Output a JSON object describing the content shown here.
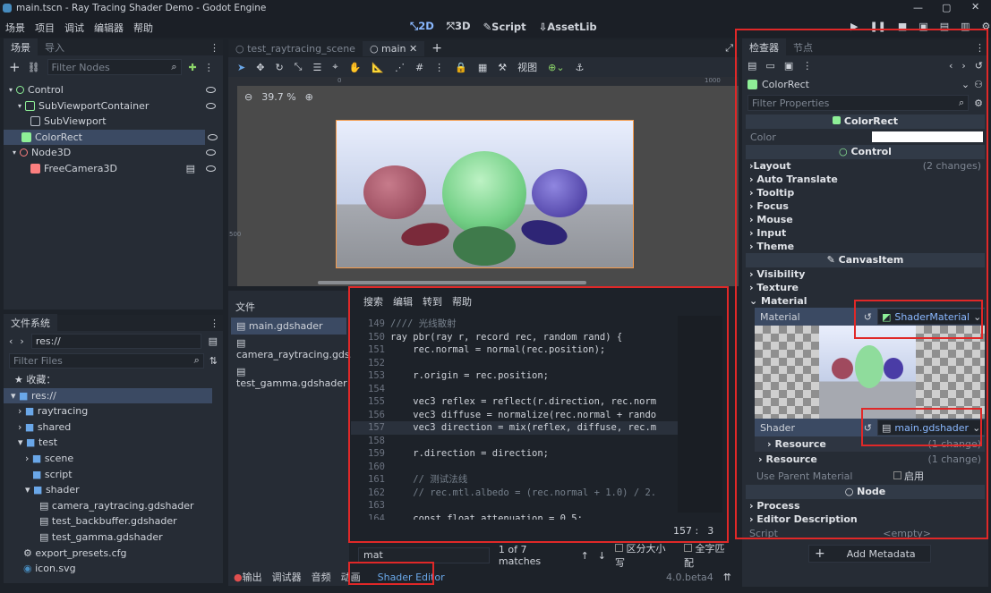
{
  "window": {
    "title": "main.tscn - Ray Tracing Shader Demo - Godot Engine"
  },
  "menu": [
    "场景",
    "项目",
    "调试",
    "编辑器",
    "帮助"
  ],
  "main_tabs": [
    {
      "label": "2D",
      "active": true
    },
    {
      "label": "3D"
    },
    {
      "label": "Script"
    },
    {
      "label": "AssetLib"
    }
  ],
  "scene_dock": {
    "tabs": [
      "场景",
      "导入"
    ],
    "filter_placeholder": "Filter Nodes",
    "nodes": [
      {
        "label": "Control",
        "icon": "control-icon"
      },
      {
        "label": "SubViewportContainer",
        "icon": "container-icon"
      },
      {
        "label": "SubViewport",
        "icon": "viewport-icon"
      },
      {
        "label": "ColorRect",
        "icon": "colorrect-icon",
        "selected": true
      },
      {
        "label": "Node3D",
        "icon": "node3d-icon"
      },
      {
        "label": "FreeCamera3D",
        "icon": "camera-icon"
      }
    ]
  },
  "filesystem": {
    "title": "文件系统",
    "path": "res://",
    "filter_placeholder": "Filter Files",
    "favorites": "收藏：",
    "items": [
      {
        "label": "res://",
        "selected": true
      },
      {
        "label": "raytracing"
      },
      {
        "label": "shared"
      },
      {
        "label": "test"
      },
      {
        "label": "scene"
      },
      {
        "label": "script"
      },
      {
        "label": "shader"
      },
      {
        "label": "camera_raytracing.gdshader"
      },
      {
        "label": "test_backbuffer.gdshader"
      },
      {
        "label": "test_gamma.gdshader"
      },
      {
        "label": "export_presets.cfg"
      },
      {
        "label": "icon.svg"
      }
    ]
  },
  "editor_tabs": [
    {
      "label": "test_raytracing_scene"
    },
    {
      "label": "main",
      "active": true
    }
  ],
  "viewport": {
    "zoom": "39.7 %",
    "view_menu": "视图",
    "ruler_marks": [
      "0",
      "1000",
      "500"
    ]
  },
  "shader_files": {
    "title": "文件",
    "items": [
      "main.gdshader",
      "camera_raytracing.gds...",
      "test_gamma.gdshader"
    ]
  },
  "shader_menu": [
    "搜索",
    "编辑",
    "转到",
    "帮助"
  ],
  "code_lines": [
    {
      "n": "149",
      "t": "//// 光线散射"
    },
    {
      "n": "150",
      "t": "ray pbr(ray r, record rec, random rand) {"
    },
    {
      "n": "151",
      "t": "    rec.normal = normal(rec.position);"
    },
    {
      "n": "152",
      "t": ""
    },
    {
      "n": "153",
      "t": "    r.origin = rec.position;"
    },
    {
      "n": "154",
      "t": ""
    },
    {
      "n": "155",
      "t": "    vec3 reflex = reflect(r.direction, rec.norm"
    },
    {
      "n": "156",
      "t": "    vec3 diffuse = normalize(rec.normal + rando"
    },
    {
      "n": "157",
      "t": "    vec3 direction = mix(reflex, diffuse, rec.m"
    },
    {
      "n": "158",
      "t": ""
    },
    {
      "n": "159",
      "t": "    r.direction = direction;"
    },
    {
      "n": "160",
      "t": ""
    },
    {
      "n": "161",
      "t": "    // 测试法线"
    },
    {
      "n": "162",
      "t": "    // rec.mtl.albedo = (rec.normal + 1.0) / 2."
    },
    {
      "n": "163",
      "t": ""
    },
    {
      "n": "164",
      "t": "    const float attenuation = 0.5;"
    }
  ],
  "cursor_pos": "157 :",
  "cursor_col": "3",
  "find": {
    "value": "mat",
    "matches": "1 of 7 matches",
    "case": "区分大小写",
    "whole": "全字匹配"
  },
  "bottom_tabs": [
    "输出",
    "调试器",
    "音频",
    "动画",
    "Shader Editor"
  ],
  "version": "4.0.beta4",
  "inspector": {
    "tabs": [
      "检查器",
      "节点"
    ],
    "node": "ColorRect",
    "filter_placeholder": "Filter Properties",
    "class_header": "ColorRect",
    "color_label": "Color",
    "color_value": "#ffffff",
    "control_header": "Control",
    "groups": [
      {
        "label": "Layout",
        "note": "(2 changes)"
      },
      {
        "label": "Auto Translate"
      },
      {
        "label": "Tooltip"
      },
      {
        "label": "Focus"
      },
      {
        "label": "Mouse"
      },
      {
        "label": "Input"
      },
      {
        "label": "Theme"
      }
    ],
    "canvasitem_header": "CanvasItem",
    "ci_groups": [
      "Visibility",
      "Texture",
      "Material"
    ],
    "material_label": "Material",
    "material_value": "ShaderMaterial",
    "shader_label": "Shader",
    "shader_value": "main.gdshader",
    "resource_inner": "Resource",
    "resource_inner_note": "(1 change)",
    "resource": "Resource",
    "resource_note": "(1 change)",
    "use_parent": "Use Parent Material",
    "use_parent_value": "启用",
    "node_header": "Node",
    "process": "Process",
    "editor_desc": "Editor Description",
    "script_label": "Script",
    "script_value": "<empty>",
    "add_meta": "Add Metadata"
  }
}
